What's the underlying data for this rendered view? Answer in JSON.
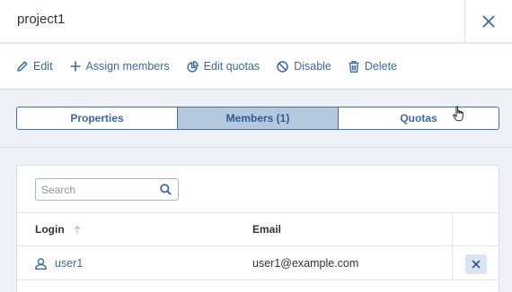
{
  "header": {
    "title": "project1"
  },
  "toolbar": {
    "edit": "Edit",
    "assign_members": "Assign members",
    "edit_quotas": "Edit quotas",
    "disable": "Disable",
    "delete": "Delete"
  },
  "tabs": [
    {
      "label": "Properties",
      "active": false
    },
    {
      "label": "Members (1)",
      "active": true
    },
    {
      "label": "Quotas",
      "active": false
    }
  ],
  "search": {
    "placeholder": "Search",
    "value": ""
  },
  "table": {
    "columns": {
      "login": "Login",
      "email": "Email"
    },
    "rows": [
      {
        "login": "user1",
        "email": "user1@example.com"
      }
    ]
  },
  "colors": {
    "accent": "#3a6aa8",
    "tab_active_bg": "#b6c8e0",
    "background": "#eef1f5"
  },
  "icons": [
    "close-icon",
    "pencil-icon",
    "plus-icon",
    "pie-chart-icon",
    "ban-icon",
    "trash-icon",
    "search-icon",
    "sort-up-icon",
    "user-icon",
    "remove-icon",
    "hand-cursor-icon"
  ]
}
